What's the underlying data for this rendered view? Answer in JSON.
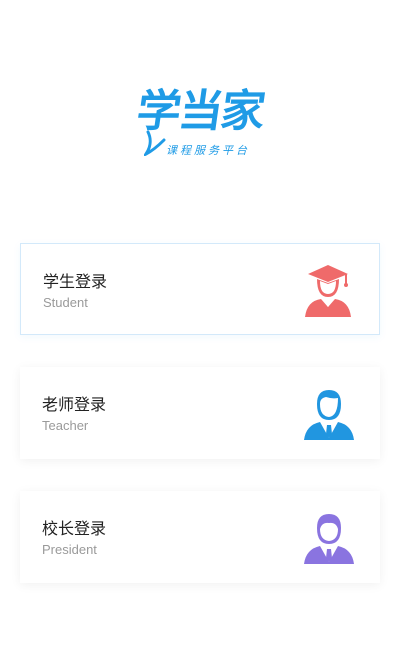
{
  "logo": {
    "title": "学当家",
    "subtitle": "课程服务平台"
  },
  "options": [
    {
      "title": "学生登录",
      "subtitle": "Student",
      "icon": "student-icon",
      "color": "#ef6a6a"
    },
    {
      "title": "老师登录",
      "subtitle": "Teacher",
      "icon": "teacher-icon",
      "color": "#2196e0"
    },
    {
      "title": "校长登录",
      "subtitle": "President",
      "icon": "president-icon",
      "color": "#8a74e0"
    }
  ],
  "colors": {
    "brand": "#1f9be6"
  }
}
